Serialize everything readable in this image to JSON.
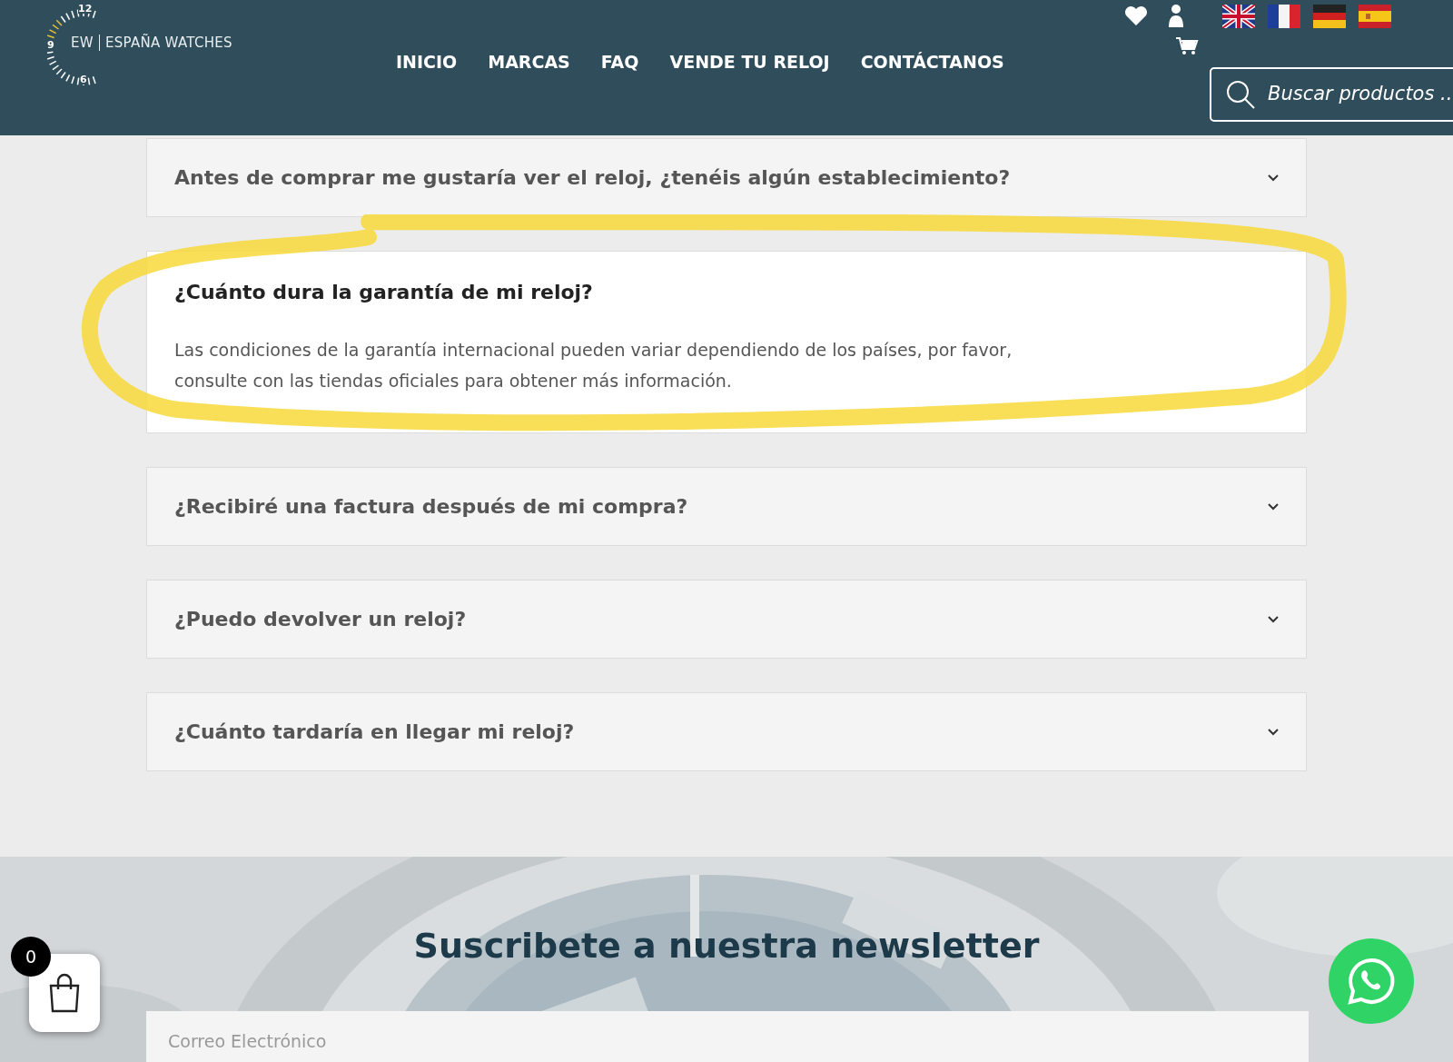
{
  "header": {
    "logo": {
      "mark": "EW",
      "name": "ESPAÑA WATCHES",
      "dial": [
        "12",
        "9",
        "6"
      ]
    },
    "nav": [
      {
        "label": "INICIO"
      },
      {
        "label": "MARCAS"
      },
      {
        "label": "FAQ"
      },
      {
        "label": "VENDE TU RELOJ"
      },
      {
        "label": "CONTÁCTANOS"
      }
    ],
    "languages": [
      {
        "kind": "uk"
      },
      {
        "kind": "fr"
      },
      {
        "kind": "de"
      },
      {
        "kind": "es"
      }
    ],
    "search": {
      "placeholder": "Buscar productos ..."
    }
  },
  "faq": [
    {
      "question": "Antes de comprar me gustaría ver el reloj, ¿tenéis algún establecimiento?",
      "expanded": false
    },
    {
      "question": "¿Cuánto dura la garantía de mi reloj?",
      "expanded": true,
      "highlighted": true,
      "answer": "Las condiciones de la garantía internacional pueden variar dependiendo de los países, por favor, consulte con las tiendas oficiales para obtener más información."
    },
    {
      "question": "¿Recibiré una factura después de mi compra?",
      "expanded": false
    },
    {
      "question": "¿Puedo devolver un reloj?",
      "expanded": false
    },
    {
      "question": "¿Cuánto tardaría en llegar mi reloj?",
      "expanded": false
    }
  ],
  "newsletter": {
    "title": "Suscribete a nuestra newsletter",
    "email": {
      "placeholder": "Correo Electrónico"
    }
  },
  "cart": {
    "count": "0"
  }
}
